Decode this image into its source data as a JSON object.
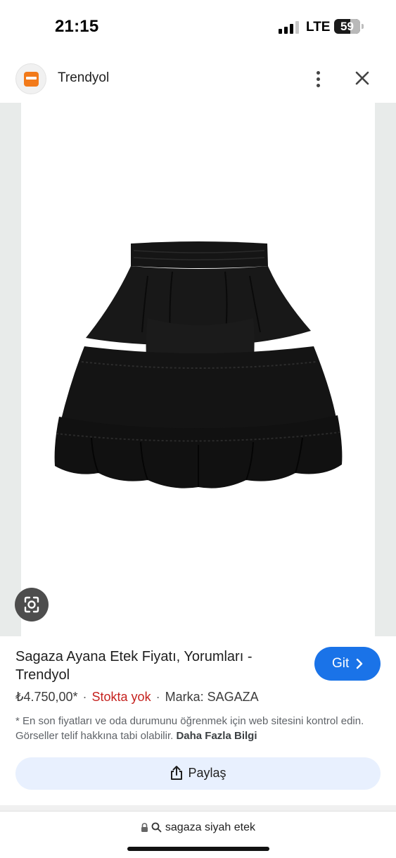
{
  "status_bar": {
    "time": "21:15",
    "network": "LTE",
    "battery_level": "59",
    "signal_bars_active": 3,
    "signal_bars_total": 4
  },
  "header": {
    "site_name": "Trendyol",
    "logo_icon": "trendyol-logo",
    "more_icon": "more-vert-icon",
    "close_icon": "close-icon"
  },
  "image": {
    "subject": "black-tiered-ruffle-skirt",
    "lens_icon": "google-lens-icon"
  },
  "product": {
    "title": "Sagaza Ayana Etek Fiyatı, Yorumları - Trendyol",
    "go_label": "Git",
    "price": "₺4.750,00*",
    "stock": "Stokta yok",
    "brand": "Marka: SAGAZA",
    "disclaimer": "* En son fiyatları ve oda durumunu öğrenmek için web sitesini kontrol edin. Görseller telif hakkına tabi olabilir.",
    "more_info": "Daha Fazla Bilgi",
    "share_label": "Paylaş"
  },
  "address_bar": {
    "query": "sagaza siyah etek"
  },
  "colors": {
    "accent_blue": "#1a73e8",
    "share_bg": "#e8f0fe",
    "stock_red": "#c5221f",
    "brand_orange": "#f27a1a"
  }
}
